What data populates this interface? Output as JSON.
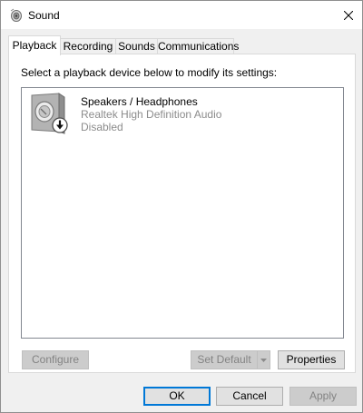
{
  "window": {
    "title": "Sound"
  },
  "tabs": [
    {
      "label": "Playback",
      "active": true
    },
    {
      "label": "Recording",
      "active": false
    },
    {
      "label": "Sounds",
      "active": false
    },
    {
      "label": "Communications",
      "active": false
    }
  ],
  "playback": {
    "instruction": "Select a playback device below to modify its settings:",
    "devices": [
      {
        "name": "Speakers / Headphones",
        "driver": "Realtek High Definition Audio",
        "status": "Disabled",
        "icon": "speaker-disabled-icon"
      }
    ],
    "buttons": {
      "configure": "Configure",
      "set_default": "Set Default",
      "properties": "Properties"
    }
  },
  "dialog_buttons": {
    "ok": "OK",
    "cancel": "Cancel",
    "apply": "Apply"
  },
  "colors": {
    "accent": "#0078d7",
    "disabled_text": "#838383",
    "secondary_text": "#8c8c8c"
  }
}
